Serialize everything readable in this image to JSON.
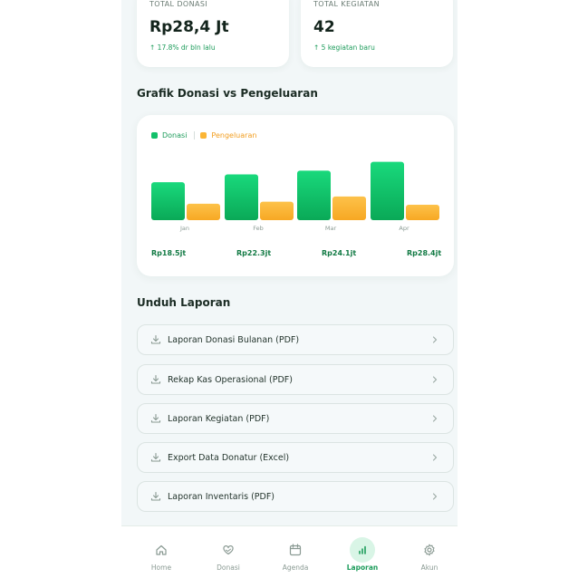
{
  "stats": [
    {
      "label": "TOTAL DONASI",
      "value": "Rp28,4 Jt",
      "change": "↑ 17.8% dr bln lalu"
    },
    {
      "label": "TOTAL KEGIATAN",
      "value": "42",
      "change": "↑ 5 kegiatan baru"
    }
  ],
  "chart_section": {
    "title": "Grafik Donasi vs Pengeluaran"
  },
  "chart_data": {
    "type": "bar",
    "categories": [
      "Jan",
      "Feb",
      "Mar",
      "Apr"
    ],
    "series": [
      {
        "name": "Donasi",
        "values": [
          18.5,
          22.3,
          24.1,
          28.4
        ],
        "color": "#12c06a"
      },
      {
        "name": "Pengeluaran",
        "values": [
          8,
          9,
          11.5,
          7.5
        ],
        "color": "#fbb535"
      }
    ],
    "totals": [
      "Rp18.5jt",
      "Rp22.3jt",
      "Rp24.1jt",
      "Rp28.4jt"
    ],
    "ylim": [
      0,
      30
    ],
    "grid": false,
    "legend_position": "top-left"
  },
  "reports": {
    "title": "Unduh Laporan",
    "items": [
      {
        "label": "Laporan Donasi Bulanan (PDF)"
      },
      {
        "label": "Rekap Kas Operasional (PDF)"
      },
      {
        "label": "Laporan Kegiatan (PDF)"
      },
      {
        "label": "Export Data Donatur (Excel)"
      },
      {
        "label": "Laporan Inventaris (PDF)"
      }
    ]
  },
  "nav": {
    "items": [
      {
        "label": "Home",
        "icon": "home-icon"
      },
      {
        "label": "Donasi",
        "icon": "heart-hand-icon"
      },
      {
        "label": "Agenda",
        "icon": "calendar-icon"
      },
      {
        "label": "Laporan",
        "icon": "bar-chart-icon",
        "active": true
      },
      {
        "label": "Akun",
        "icon": "gear-icon"
      }
    ]
  }
}
